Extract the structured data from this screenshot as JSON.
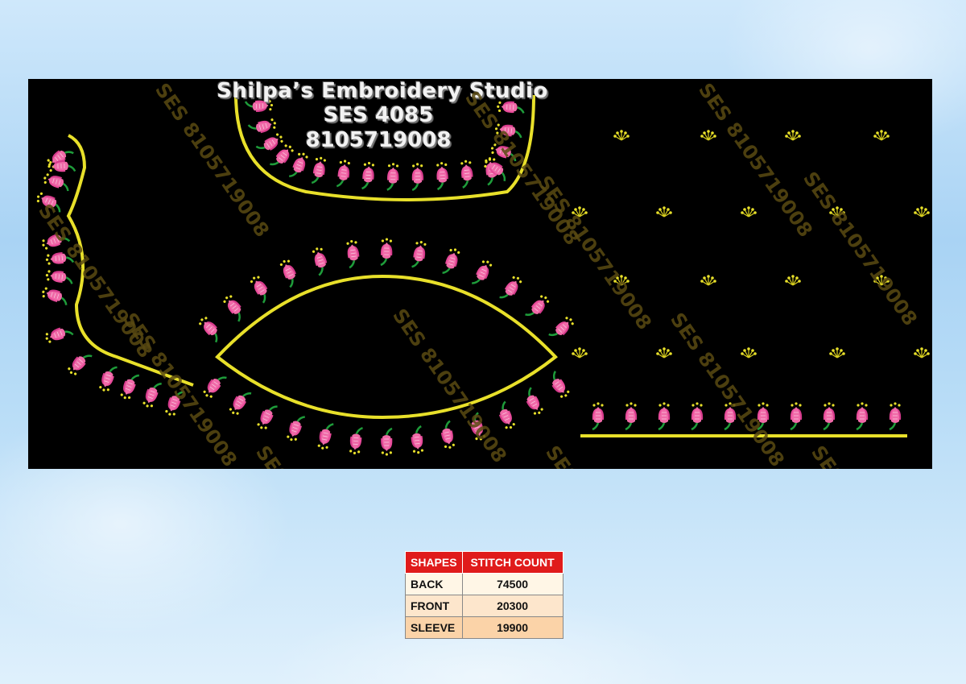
{
  "studio": {
    "name": "Shilpa’s Embroidery Studio",
    "code": "SES 4085",
    "phone": "8105719008"
  },
  "watermark": "SES 8105719008",
  "colors": {
    "flower": "#e84a9a",
    "leaf": "#1e9c3a",
    "outline": "#e8e02a",
    "panel": "#000000",
    "table_header": "#e01b1b"
  },
  "table": {
    "headers": [
      "SHAPES",
      "STITCH COUNT"
    ],
    "rows": [
      {
        "shape": "BACK",
        "count": "74500"
      },
      {
        "shape": "FRONT",
        "count": "20300"
      },
      {
        "shape": "SLEEVE",
        "count": "19900"
      }
    ]
  }
}
